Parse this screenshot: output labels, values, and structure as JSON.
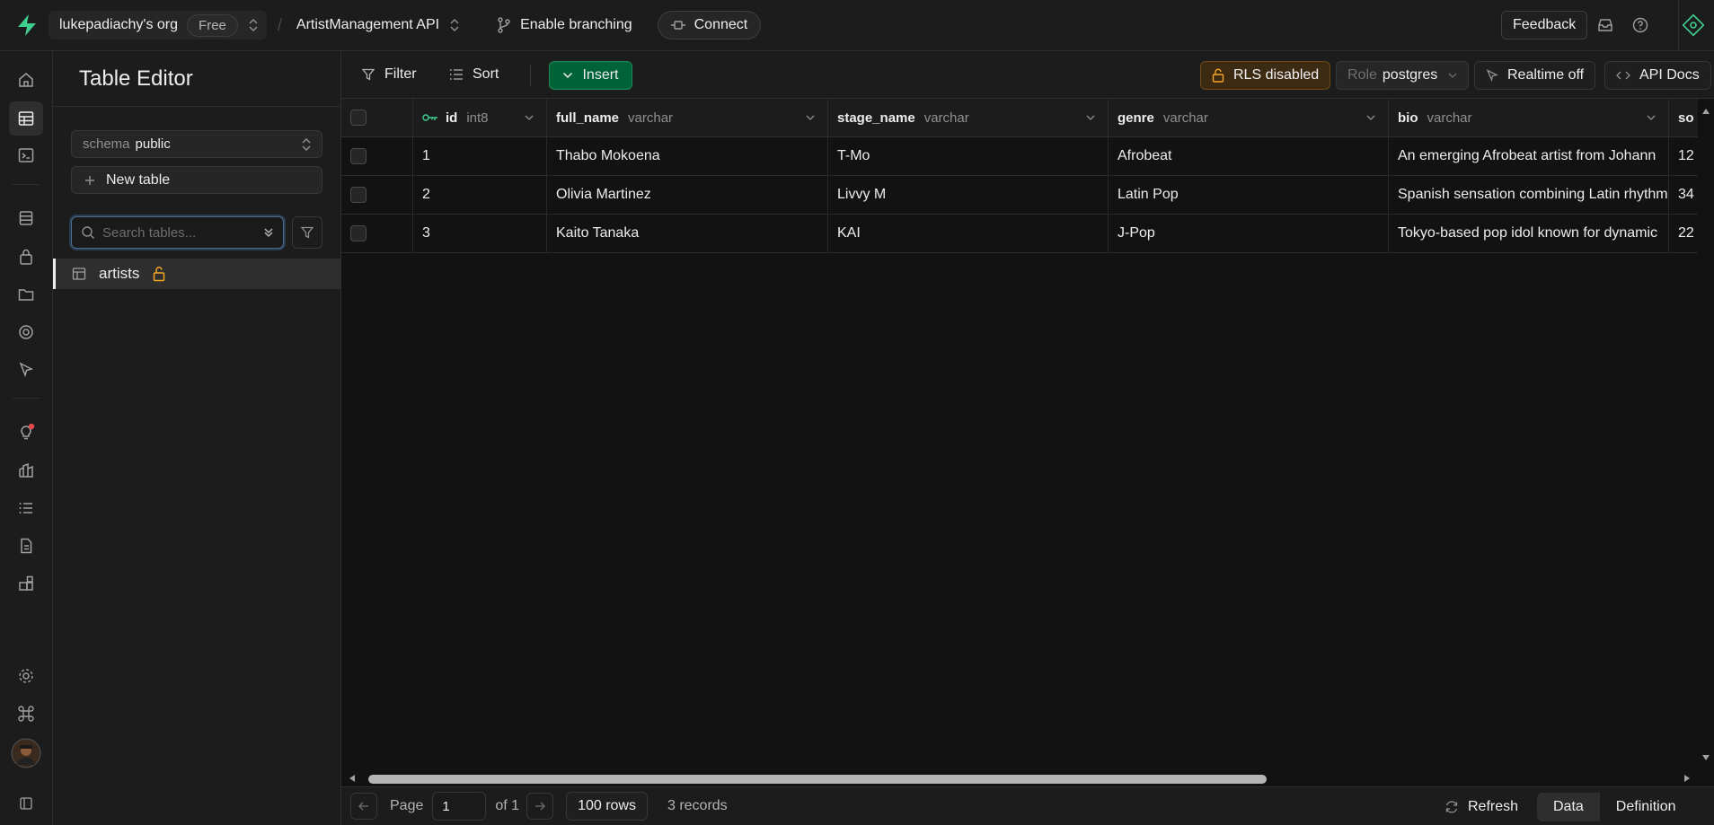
{
  "topbar": {
    "org_name": "lukepadiachy's org",
    "plan_badge": "Free",
    "separator": "/",
    "project_name": "ArtistManagement API",
    "branching_label": "Enable branching",
    "connect_label": "Connect",
    "feedback_label": "Feedback"
  },
  "sidebar": {
    "title": "Table Editor",
    "schema_label": "schema",
    "schema_value": "public",
    "new_table_label": "New table",
    "search_placeholder": "Search tables...",
    "tables": [
      {
        "name": "artists",
        "rls_icon": "unlock-icon"
      }
    ]
  },
  "toolbar": {
    "filter_label": "Filter",
    "sort_label": "Sort",
    "insert_label": "Insert",
    "rls_label": "RLS disabled",
    "role_label": "Role",
    "role_value": "postgres",
    "realtime_label": "Realtime off",
    "api_docs_label": "API Docs"
  },
  "grid": {
    "columns": [
      {
        "name": "id",
        "type": "int8",
        "primary_key": true
      },
      {
        "name": "full_name",
        "type": "varchar"
      },
      {
        "name": "stage_name",
        "type": "varchar"
      },
      {
        "name": "genre",
        "type": "varchar"
      },
      {
        "name": "bio",
        "type": "varchar"
      },
      {
        "name": "so",
        "type": ""
      }
    ],
    "rows": [
      {
        "id": "1",
        "full_name": "Thabo Mokoena",
        "stage_name": "T-Mo",
        "genre": "Afrobeat",
        "bio": "An emerging Afrobeat artist from Johann",
        "extra": "12"
      },
      {
        "id": "2",
        "full_name": "Olivia Martinez",
        "stage_name": "Livvy M",
        "genre": "Latin Pop",
        "bio": "Spanish sensation combining Latin rhythm",
        "extra": "34"
      },
      {
        "id": "3",
        "full_name": "Kaito Tanaka",
        "stage_name": "KAI",
        "genre": "J-Pop",
        "bio": "Tokyo-based pop idol known for dynamic",
        "extra": "22"
      }
    ]
  },
  "footer": {
    "page_label": "Page",
    "page_value": "1",
    "of_label": "of 1",
    "rows_label": "100 rows",
    "records_label": "3 records",
    "refresh_label": "Refresh",
    "data_tab": "Data",
    "definition_tab": "Definition"
  },
  "colors": {
    "brand": "#3ecf8e",
    "insert_bg": "#006239",
    "rls_bg": "#3d2a12",
    "lock_orange": "#f5a623"
  }
}
